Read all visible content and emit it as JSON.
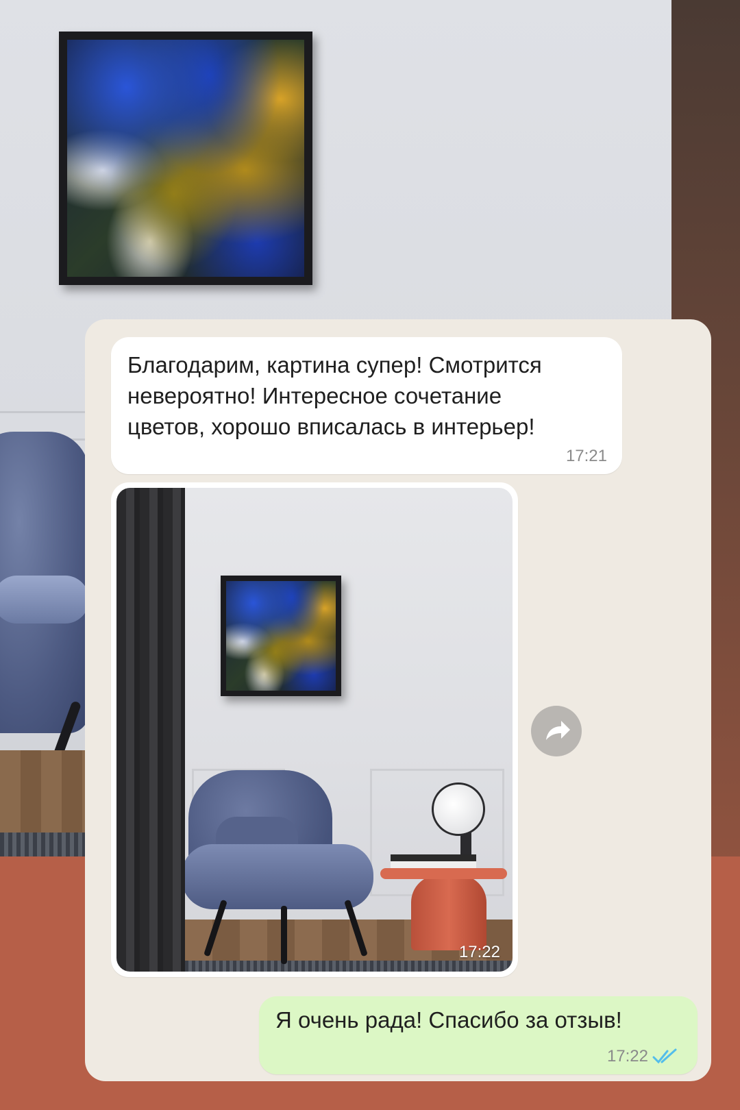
{
  "messages": {
    "incoming_text": "Благодарим, картина супер! Смотрится\nневероятно! Интересное сочетание\nцветов, хорошо вписалась в интерьер!",
    "incoming_time": "17:21",
    "media_time": "17:22",
    "outgoing_text": "Я очень рада! Спасибо за отзыв!",
    "outgoing_time": "17:22",
    "outgoing_status": "read"
  },
  "icons": {
    "forward": "forward-arrow-icon",
    "read_receipt": "double-check-icon"
  },
  "colors": {
    "chat_background": "#efeae2",
    "incoming_bubble": "#ffffff",
    "outgoing_bubble": "#dcf7c5",
    "read_ticks": "#53bdeb",
    "page_background": "#b9614a"
  }
}
